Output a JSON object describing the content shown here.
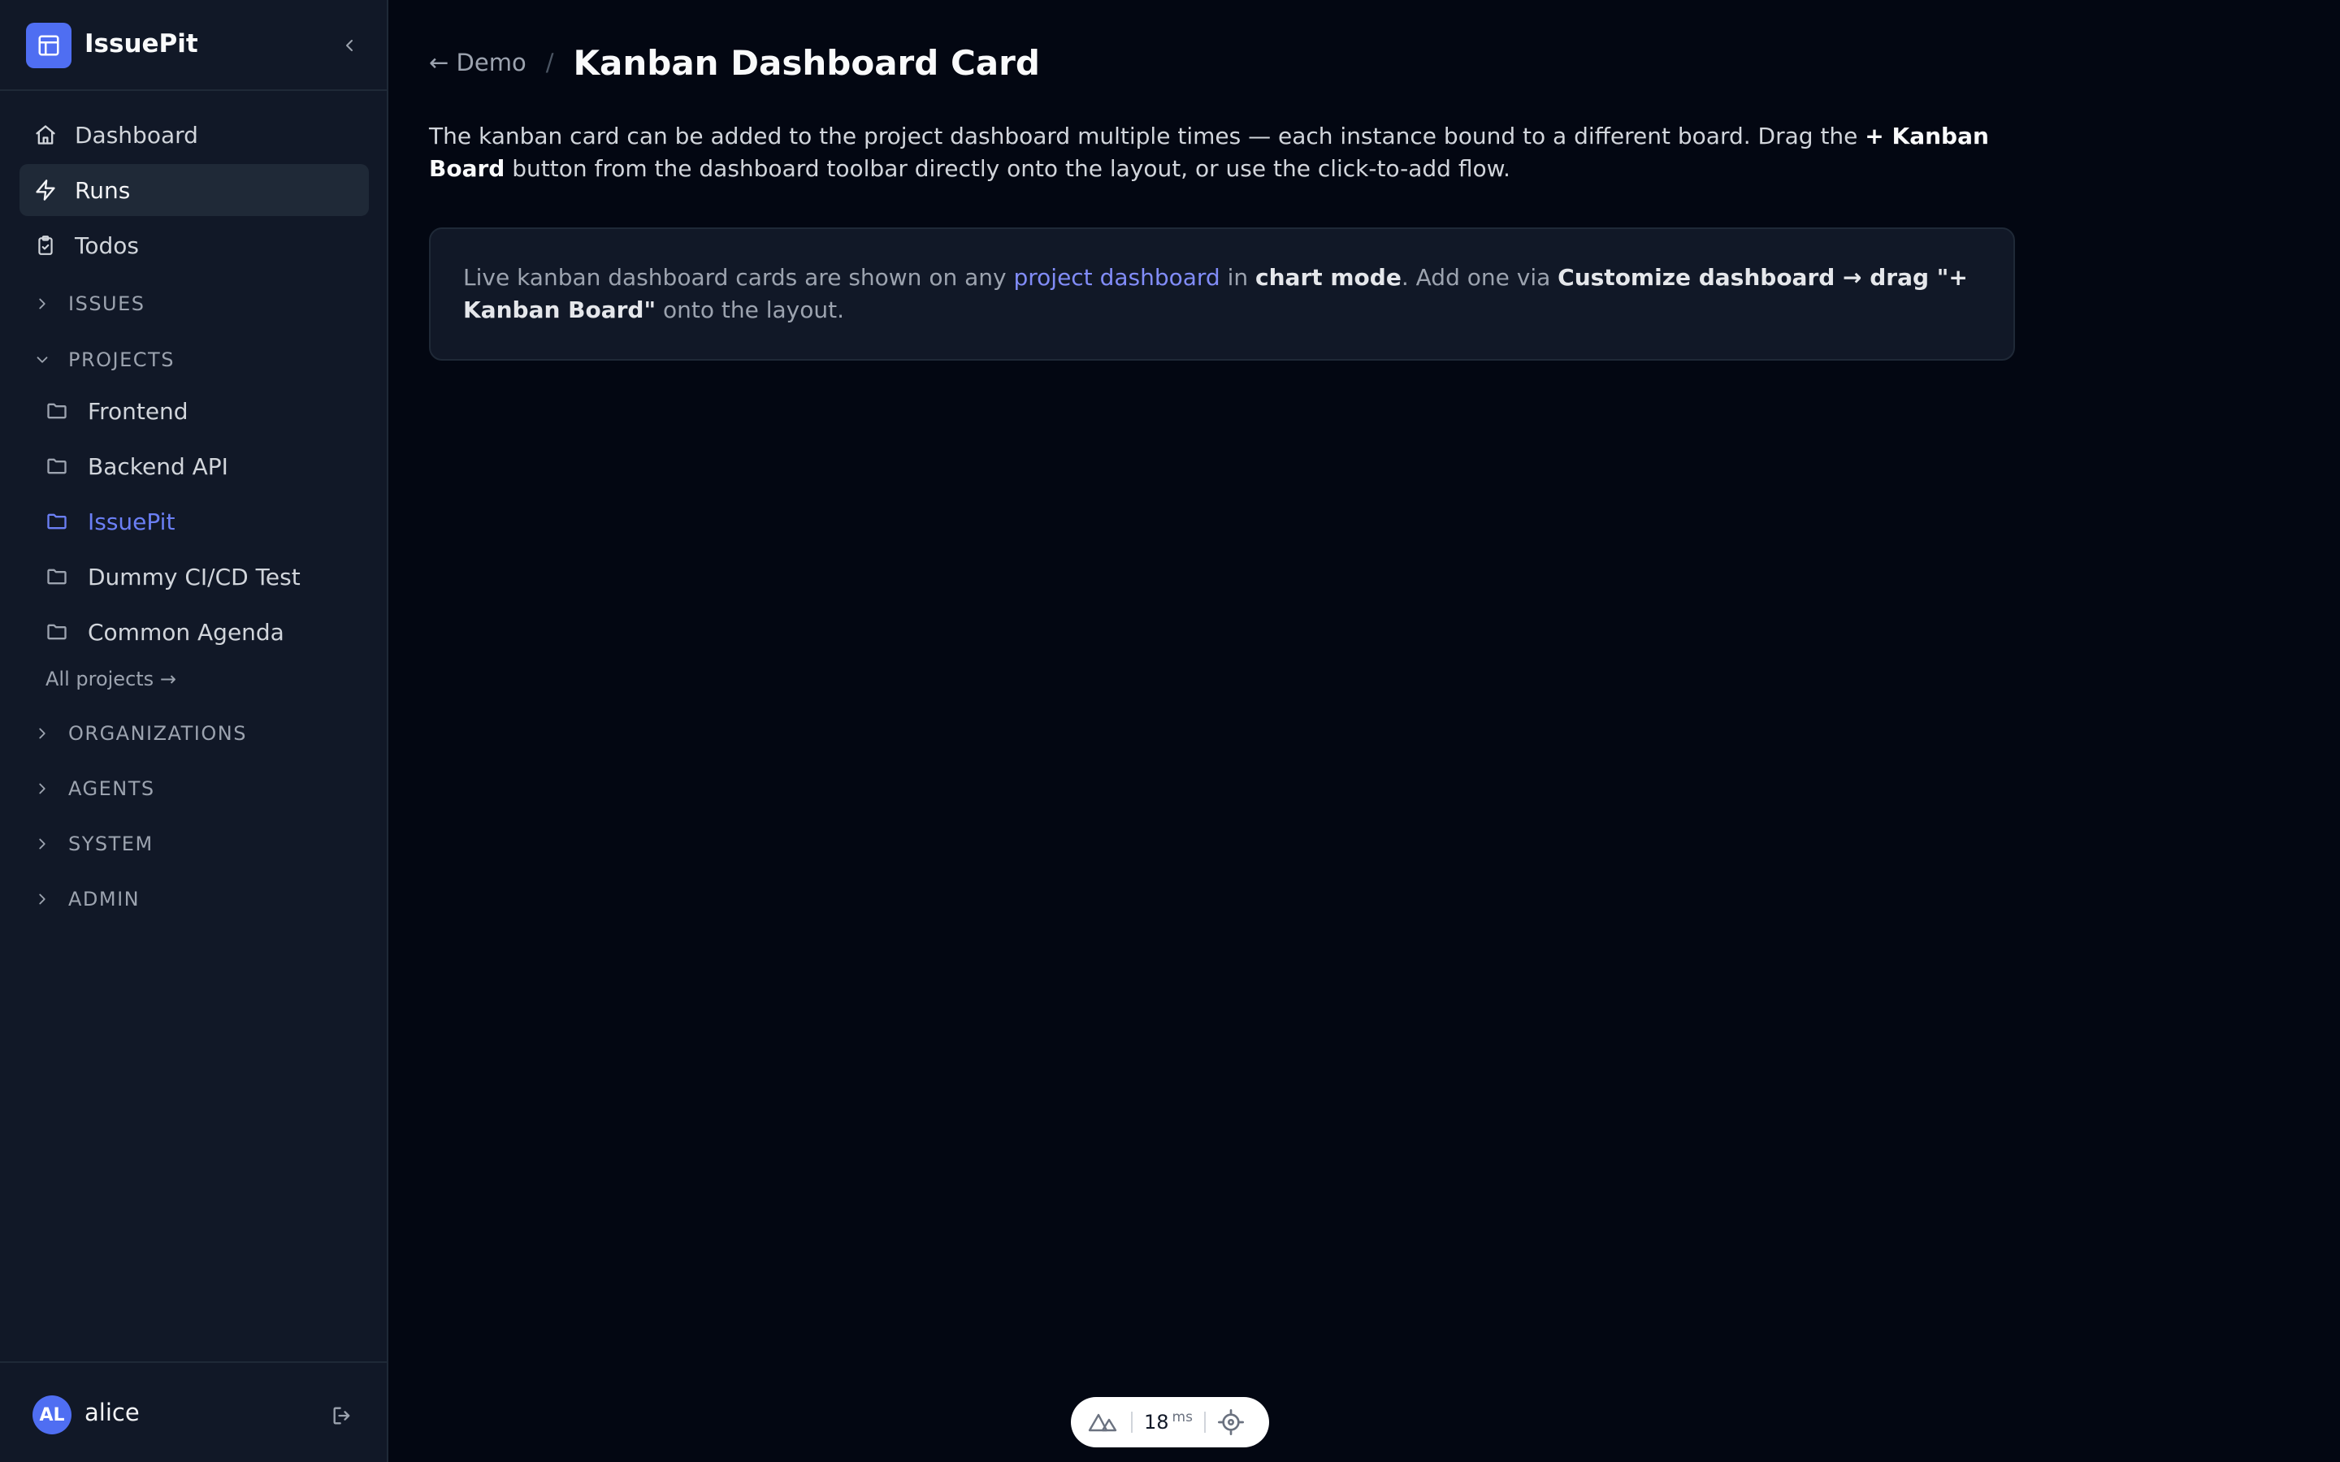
{
  "app": {
    "name": "IssuePit"
  },
  "sidebar": {
    "nav": [
      {
        "label": "Dashboard",
        "icon": "home-icon"
      },
      {
        "label": "Runs",
        "icon": "lightning-icon"
      },
      {
        "label": "Todos",
        "icon": "clipboard-check-icon"
      }
    ],
    "sections": {
      "issues": "ISSUES",
      "projects": "PROJECTS",
      "organizations": "ORGANIZATIONS",
      "agents": "AGENTS",
      "system": "SYSTEM",
      "admin": "ADMIN"
    },
    "projects": [
      {
        "label": "Frontend"
      },
      {
        "label": "Backend API"
      },
      {
        "label": "IssuePit"
      },
      {
        "label": "Dummy CI/CD Test"
      },
      {
        "label": "Common Agenda"
      }
    ],
    "all_projects": "All projects →",
    "user": {
      "initials": "AL",
      "name": "alice"
    }
  },
  "breadcrumb": {
    "back": "← Demo",
    "separator": "/",
    "title": "Kanban Dashboard Card"
  },
  "intro": {
    "text1": "The kanban card can be added to the project dashboard multiple times — each instance bound to a different board. Drag the ",
    "bold1": "+ Kanban Board",
    "text2": " button from the dashboard toolbar directly onto the layout, or use the click-to-add flow."
  },
  "info": {
    "text1": "Live kanban dashboard cards are shown on any ",
    "link": "project dashboard",
    "text2": " in ",
    "bold1": "chart mode",
    "text3": ". Add one via ",
    "bold2": "Customize dashboard → drag \"+ Kanban Board\"",
    "text4": " onto the layout."
  },
  "devtools": {
    "render_time": "18",
    "unit": "ms"
  },
  "colors": {
    "accent": "#4f6ef2",
    "active_project": "#6b7ff5",
    "link": "#818cf8",
    "background": "#030712",
    "sidebar": "#111827"
  }
}
